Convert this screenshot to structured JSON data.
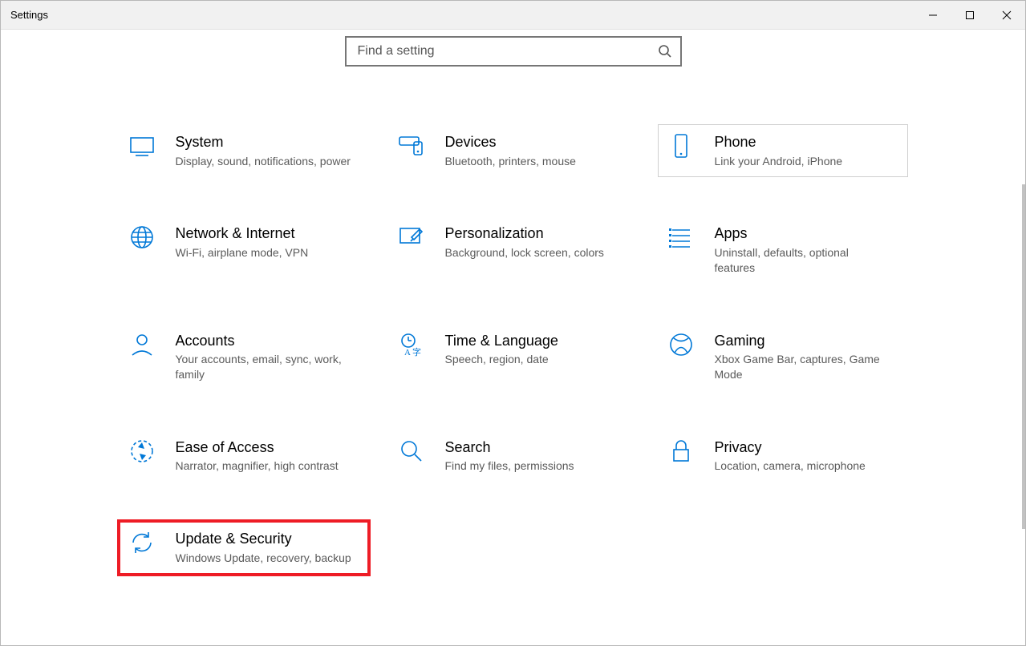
{
  "window": {
    "title": "Settings"
  },
  "search": {
    "placeholder": "Find a setting"
  },
  "tiles": {
    "system": {
      "title": "System",
      "desc": "Display, sound, notifications, power"
    },
    "devices": {
      "title": "Devices",
      "desc": "Bluetooth, printers, mouse"
    },
    "phone": {
      "title": "Phone",
      "desc": "Link your Android, iPhone"
    },
    "network": {
      "title": "Network & Internet",
      "desc": "Wi-Fi, airplane mode, VPN"
    },
    "personalization": {
      "title": "Personalization",
      "desc": "Background, lock screen, colors"
    },
    "apps": {
      "title": "Apps",
      "desc": "Uninstall, defaults, optional features"
    },
    "accounts": {
      "title": "Accounts",
      "desc": "Your accounts, email, sync, work, family"
    },
    "time": {
      "title": "Time & Language",
      "desc": "Speech, region, date"
    },
    "gaming": {
      "title": "Gaming",
      "desc": "Xbox Game Bar, captures, Game Mode"
    },
    "ease": {
      "title": "Ease of Access",
      "desc": "Narrator, magnifier, high contrast"
    },
    "searchcat": {
      "title": "Search",
      "desc": "Find my files, permissions"
    },
    "privacy": {
      "title": "Privacy",
      "desc": "Location, camera, microphone"
    },
    "update": {
      "title": "Update & Security",
      "desc": "Windows Update, recovery, backup"
    }
  }
}
